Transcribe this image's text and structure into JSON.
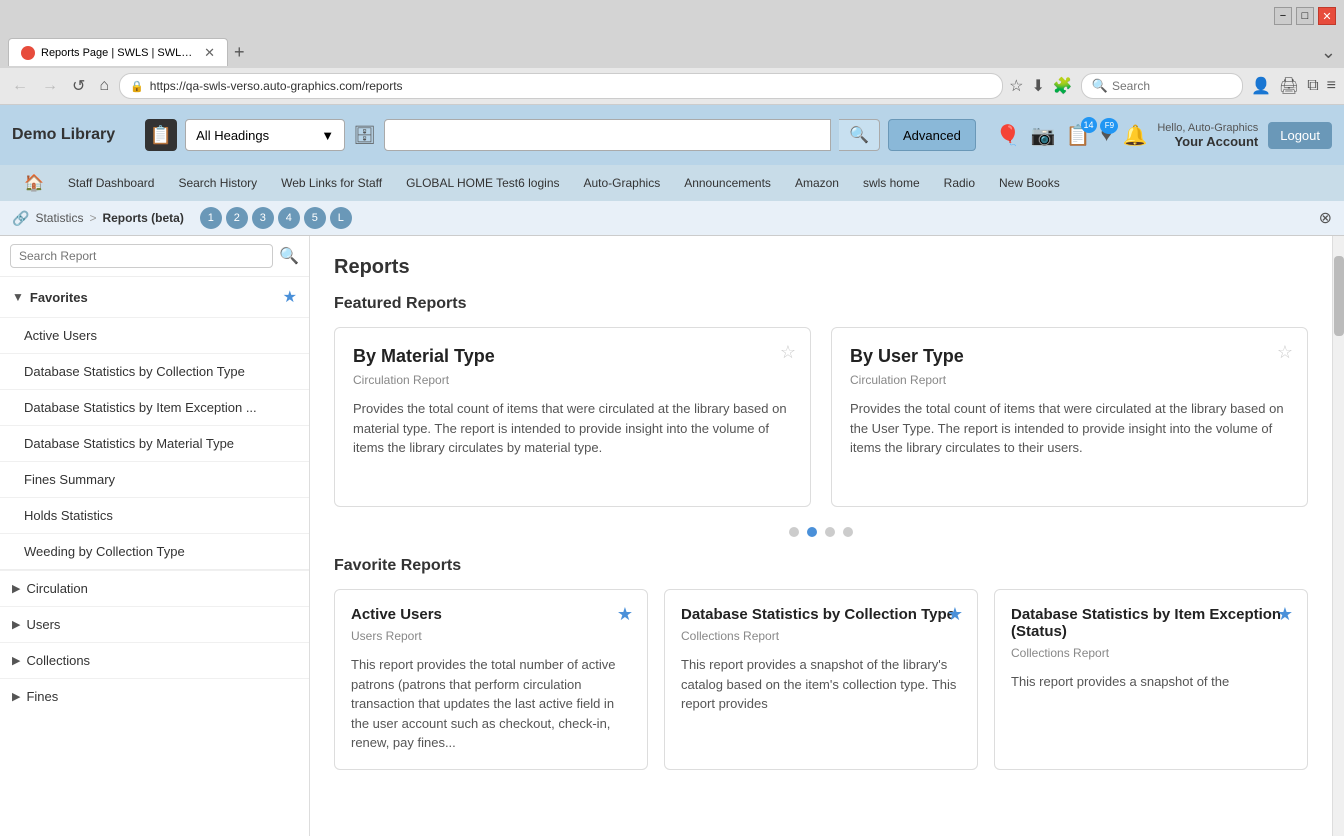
{
  "browser": {
    "tab_title": "Reports Page | SWLS | SWLS | A...",
    "url": "https://qa-swls-verso.auto-graphics.com/reports",
    "new_tab_label": "+",
    "search_placeholder": "Search",
    "nav": {
      "back": "←",
      "forward": "→",
      "refresh": "↺",
      "home": "⌂"
    },
    "icons": {
      "star": "☆",
      "download": "⬇",
      "shield": "🛡",
      "lock": "🔒",
      "extensions": "🧩",
      "menu": "≡",
      "bookmark": "🔖",
      "more": "⋮"
    },
    "window_controls": {
      "minimize": "−",
      "maximize": "□",
      "close": "✕"
    },
    "scroll_down": "⌄"
  },
  "app": {
    "library_name": "Demo Library",
    "search": {
      "heading_dropdown": "All Headings",
      "advanced_btn": "Advanced",
      "search_placeholder": ""
    },
    "nav_links": [
      {
        "label": "🏠",
        "id": "home"
      },
      {
        "label": "Staff Dashboard",
        "id": "staff-dashboard"
      },
      {
        "label": "Search History",
        "id": "search-history"
      },
      {
        "label": "Web Links for Staff",
        "id": "web-links"
      },
      {
        "label": "GLOBAL HOME Test6 logins",
        "id": "global-home"
      },
      {
        "label": "Auto-Graphics",
        "id": "auto-graphics"
      },
      {
        "label": "Announcements",
        "id": "announcements"
      },
      {
        "label": "Amazon",
        "id": "amazon"
      },
      {
        "label": "swls home",
        "id": "swls-home"
      },
      {
        "label": "Radio",
        "id": "radio"
      },
      {
        "label": "New Books",
        "id": "new-books"
      }
    ],
    "user": {
      "hello": "Hello, Auto-Graphics",
      "account": "Your Account",
      "logout": "Logout"
    },
    "header_icons": {
      "notifications_badge": "14",
      "messages_badge": "F9"
    }
  },
  "breadcrumb": {
    "icon": "🔗",
    "items": [
      "Statistics",
      "Reports (beta)"
    ],
    "separator": ">",
    "pages": [
      "1",
      "2",
      "3",
      "4",
      "5",
      "L"
    ],
    "close": "⊗"
  },
  "sidebar": {
    "search_placeholder": "Search Report",
    "search_icon": "🔍",
    "favorites_label": "Favorites",
    "favorites_star": "★",
    "favorites_items": [
      "Active Users",
      "Database Statistics by Collection Type",
      "Database Statistics by Item Exception ...",
      "Database Statistics by Material Type",
      "Fines Summary",
      "Holds Statistics",
      "Weeding by Collection Type"
    ],
    "categories": [
      {
        "label": "Circulation",
        "id": "circulation"
      },
      {
        "label": "Users",
        "id": "users"
      },
      {
        "label": "Collections",
        "id": "collections"
      },
      {
        "label": "Fines",
        "id": "fines"
      }
    ]
  },
  "reports": {
    "page_title": "Reports",
    "featured_section_title": "Featured Reports",
    "featured_reports": [
      {
        "id": "by-material-type",
        "title": "By Material Type",
        "type": "Circulation Report",
        "description": "Provides the total count of items that were circulated at the library based on material type. The report is intended to provide insight into the volume of items the library circulates by material type.",
        "starred": false
      },
      {
        "id": "by-user-type",
        "title": "By User Type",
        "type": "Circulation Report",
        "description": "Provides the total count of items that were circulated at the library based on the User Type. The report is intended to provide insight into the volume of items the library circulates to their users.",
        "starred": false
      }
    ],
    "carousel_dots": [
      {
        "active": false
      },
      {
        "active": true
      },
      {
        "active": false
      },
      {
        "active": false
      }
    ],
    "favorite_section_title": "Favorite Reports",
    "favorite_reports": [
      {
        "id": "active-users",
        "title": "Active Users",
        "type": "Users Report",
        "description": "This report provides the total number of active patrons (patrons that perform circulation transaction that updates the last active field in the user account such as checkout, check-in, renew, pay fines...",
        "starred": true
      },
      {
        "id": "db-stats-collection-type",
        "title": "Database Statistics by Collection Type",
        "type": "Collections Report",
        "description": "This report provides a snapshot of the library's catalog based on the item's collection type. This report provides",
        "starred": true
      },
      {
        "id": "db-stats-item-exception",
        "title": "Database Statistics by Item Exception (Status)",
        "type": "Collections Report",
        "description": "This report provides a snapshot of the",
        "starred": true
      }
    ]
  }
}
